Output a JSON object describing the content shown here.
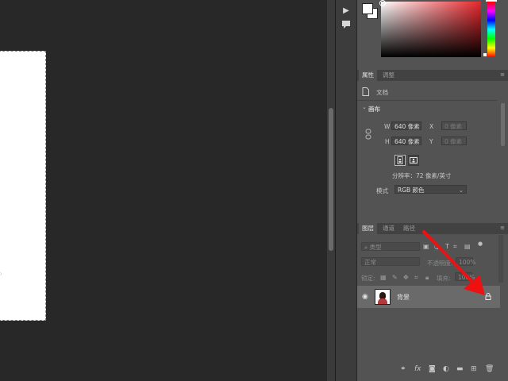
{
  "colors": {
    "accent_arrow": "#ee1111",
    "panel_bg": "#535353",
    "canvas_bg": "#282828"
  },
  "tool_strip": {
    "items": [
      "play-icon",
      "comment-icon"
    ]
  },
  "properties": {
    "tabs": [
      "属性",
      "调整"
    ],
    "doc_label": "文档",
    "section_title": "画布",
    "w_label": "W",
    "w_value": "640 像素",
    "h_label": "H",
    "h_value": "640 像素",
    "x_label": "X",
    "x_value": "0 像素",
    "y_label": "Y",
    "y_value": "0 像素",
    "resolution": "分辨率：72 像素/英寸",
    "mode_label": "模式",
    "mode_value": "RGB 颜色"
  },
  "layers": {
    "tabs": [
      "图层",
      "通道",
      "路径"
    ],
    "filter_placeholder": "类型",
    "blend_mode": "正常",
    "opacity_label": "不透明度:",
    "opacity_value": "100%",
    "lock_label": "锁定:",
    "fill_label": "填充:",
    "fill_value": "100%",
    "layer_name": "背景"
  }
}
